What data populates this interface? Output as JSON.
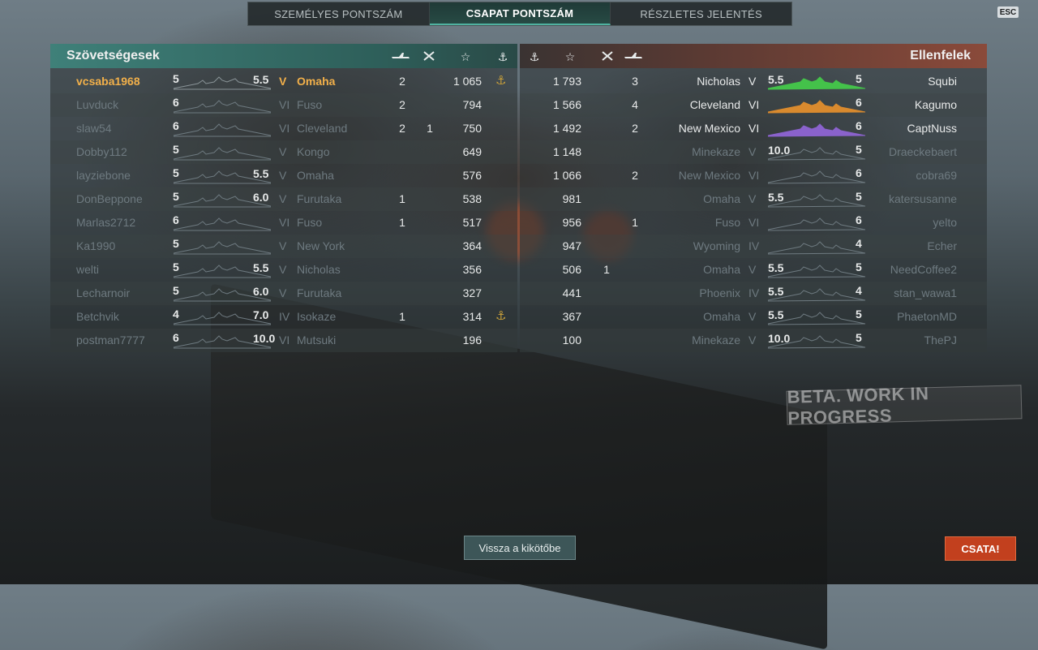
{
  "tabs": [
    {
      "label": "SZEMÉLYES PONTSZÁM",
      "active": false
    },
    {
      "label": "CSAPAT PONTSZÁM",
      "active": true
    },
    {
      "label": "RÉSZLETES JELENTÉS",
      "active": false
    }
  ],
  "esc_label": "ESC",
  "allies": {
    "title": "Szövetségesek",
    "header_icons": [
      "plane-icon",
      "fighter-icon",
      "star-icon",
      "anchor-icon"
    ],
    "rows": [
      {
        "player": "vcsaba1968",
        "lvl": "5",
        "spd": "5.5",
        "tier": "V",
        "ship": "Omaha",
        "kills": "2",
        "planes": "",
        "score": "1 065",
        "anchor": "⚓",
        "style": "gold",
        "color": "#f2b04a",
        "spark_color": "#8a9498"
      },
      {
        "player": "Luvduck",
        "lvl": "6",
        "spd": "",
        "tier": "VI",
        "ship": "Fuso",
        "kills": "2",
        "planes": "",
        "score": "794",
        "anchor": "",
        "style": "dim",
        "color": "#6e7a80",
        "spark_color": "#6e7a80"
      },
      {
        "player": "slaw54",
        "lvl": "6",
        "spd": "",
        "tier": "VI",
        "ship": "Cleveland",
        "kills": "2",
        "planes": "1",
        "score": "750",
        "anchor": "",
        "style": "dim",
        "color": "#6e7a80",
        "spark_color": "#6e7a80"
      },
      {
        "player": "Dobby112",
        "lvl": "5",
        "spd": "",
        "tier": "V",
        "ship": "Kongo",
        "kills": "",
        "planes": "",
        "score": "649",
        "anchor": "",
        "style": "dim",
        "color": "#6e7a80",
        "spark_color": "#6e7a80"
      },
      {
        "player": "layziebone",
        "lvl": "5",
        "spd": "5.5",
        "tier": "V",
        "ship": "Omaha",
        "kills": "",
        "planes": "",
        "score": "576",
        "anchor": "",
        "style": "dim",
        "color": "#6e7a80",
        "spark_color": "#6e7a80"
      },
      {
        "player": "DonBeppone",
        "lvl": "5",
        "spd": "6.0",
        "tier": "V",
        "ship": "Furutaka",
        "kills": "1",
        "planes": "",
        "score": "538",
        "anchor": "",
        "style": "dim",
        "color": "#6e7a80",
        "spark_color": "#6e7a80"
      },
      {
        "player": "Marlas2712",
        "lvl": "6",
        "spd": "",
        "tier": "VI",
        "ship": "Fuso",
        "kills": "1",
        "planes": "",
        "score": "517",
        "anchor": "",
        "style": "dim",
        "color": "#6e7a80",
        "spark_color": "#6e7a80"
      },
      {
        "player": "Ka1990",
        "lvl": "5",
        "spd": "",
        "tier": "V",
        "ship": "New York",
        "kills": "",
        "planes": "",
        "score": "364",
        "anchor": "",
        "style": "dim",
        "color": "#6e7a80",
        "spark_color": "#6e7a80"
      },
      {
        "player": "welti",
        "lvl": "5",
        "spd": "5.5",
        "tier": "V",
        "ship": "Nicholas",
        "kills": "",
        "planes": "",
        "score": "356",
        "anchor": "",
        "style": "dim",
        "color": "#6e7a80",
        "spark_color": "#6e7a80"
      },
      {
        "player": "Lecharnoir",
        "lvl": "5",
        "spd": "6.0",
        "tier": "V",
        "ship": "Furutaka",
        "kills": "",
        "planes": "",
        "score": "327",
        "anchor": "",
        "style": "dim",
        "color": "#6e7a80",
        "spark_color": "#6e7a80"
      },
      {
        "player": "Betchvik",
        "lvl": "4",
        "spd": "7.0",
        "tier": "IV",
        "ship": "Isokaze",
        "kills": "1",
        "planes": "",
        "score": "314",
        "anchor": "⚓",
        "style": "dim",
        "color": "#6e7a80",
        "spark_color": "#6e7a80"
      },
      {
        "player": "postman7777",
        "lvl": "6",
        "spd": "10.0",
        "tier": "VI",
        "ship": "Mutsuki",
        "kills": "",
        "planes": "",
        "score": "196",
        "anchor": "",
        "style": "dim",
        "color": "#6e7a80",
        "spark_color": "#6e7a80"
      }
    ]
  },
  "enemies": {
    "title": "Ellenfelek",
    "header_icons": [
      "anchor-icon",
      "star-icon",
      "fighter-icon",
      "plane-icon"
    ],
    "rows": [
      {
        "player": "Squbi",
        "lvl": "5",
        "spd": "5.5",
        "tier": "V",
        "ship": "Nicholas",
        "kills": "3",
        "planes": "",
        "score": "1 793",
        "anchor": "",
        "style": "bright",
        "color": "#e8eaea",
        "spark_color": "#44c24a"
      },
      {
        "player": "Kagumo",
        "lvl": "6",
        "spd": "",
        "tier": "VI",
        "ship": "Cleveland",
        "kills": "4",
        "planes": "",
        "score": "1 566",
        "anchor": "",
        "style": "bright",
        "color": "#e8eaea",
        "spark_color": "#d98a2e"
      },
      {
        "player": "CaptNuss",
        "lvl": "6",
        "spd": "",
        "tier": "VI",
        "ship": "New Mexico",
        "kills": "2",
        "planes": "",
        "score": "1 492",
        "anchor": "",
        "style": "bright",
        "color": "#e8eaea",
        "spark_color": "#8a62cc"
      },
      {
        "player": "Draeckebaert",
        "lvl": "5",
        "spd": "10.0",
        "tier": "V",
        "ship": "Minekaze",
        "kills": "",
        "planes": "",
        "score": "1 148",
        "anchor": "",
        "style": "dim",
        "color": "#6e7a80",
        "spark_color": "#6e7a80"
      },
      {
        "player": "cobra69",
        "lvl": "6",
        "spd": "",
        "tier": "VI",
        "ship": "New Mexico",
        "kills": "2",
        "planes": "",
        "score": "1 066",
        "anchor": "",
        "style": "dim",
        "color": "#6e7a80",
        "spark_color": "#6e7a80"
      },
      {
        "player": "katersusanne",
        "lvl": "5",
        "spd": "5.5",
        "tier": "V",
        "ship": "Omaha",
        "kills": "",
        "planes": "",
        "score": "981",
        "anchor": "",
        "style": "dim",
        "color": "#6e7a80",
        "spark_color": "#6e7a80"
      },
      {
        "player": "yelto",
        "lvl": "6",
        "spd": "",
        "tier": "VI",
        "ship": "Fuso",
        "kills": "1",
        "planes": "",
        "score": "956",
        "anchor": "",
        "style": "dim",
        "color": "#6e7a80",
        "spark_color": "#6e7a80"
      },
      {
        "player": "Echer",
        "lvl": "4",
        "spd": "",
        "tier": "IV",
        "ship": "Wyoming",
        "kills": "",
        "planes": "",
        "score": "947",
        "anchor": "",
        "style": "dim",
        "color": "#6e7a80",
        "spark_color": "#6e7a80"
      },
      {
        "player": "NeedCoffee2",
        "lvl": "5",
        "spd": "5.5",
        "tier": "V",
        "ship": "Omaha",
        "kills": "",
        "planes": "1",
        "score": "506",
        "anchor": "",
        "style": "dim",
        "color": "#6e7a80",
        "spark_color": "#6e7a80"
      },
      {
        "player": "stan_wawa1",
        "lvl": "4",
        "spd": "5.5",
        "tier": "IV",
        "ship": "Phoenix",
        "kills": "",
        "planes": "",
        "score": "441",
        "anchor": "",
        "style": "dim",
        "color": "#6e7a80",
        "spark_color": "#6e7a80"
      },
      {
        "player": "PhaetonMD",
        "lvl": "5",
        "spd": "5.5",
        "tier": "V",
        "ship": "Omaha",
        "kills": "",
        "planes": "",
        "score": "367",
        "anchor": "",
        "style": "dim",
        "color": "#6e7a80",
        "spark_color": "#6e7a80"
      },
      {
        "player": "ThePJ",
        "lvl": "5",
        "spd": "10.0",
        "tier": "V",
        "ship": "Minekaze",
        "kills": "",
        "planes": "",
        "score": "100",
        "anchor": "",
        "style": "dim",
        "color": "#6e7a80",
        "spark_color": "#6e7a80"
      }
    ]
  },
  "buttons": {
    "back": "Vissza a kikötőbe",
    "battle": "CSATA!"
  },
  "watermark": "BETA. WORK IN PROGRESS",
  "colors": {
    "ally_header": "#3f8079",
    "enemy_header": "#8a4a3a",
    "battle_button": "#c2401e",
    "gold_player": "#f2b04a"
  }
}
